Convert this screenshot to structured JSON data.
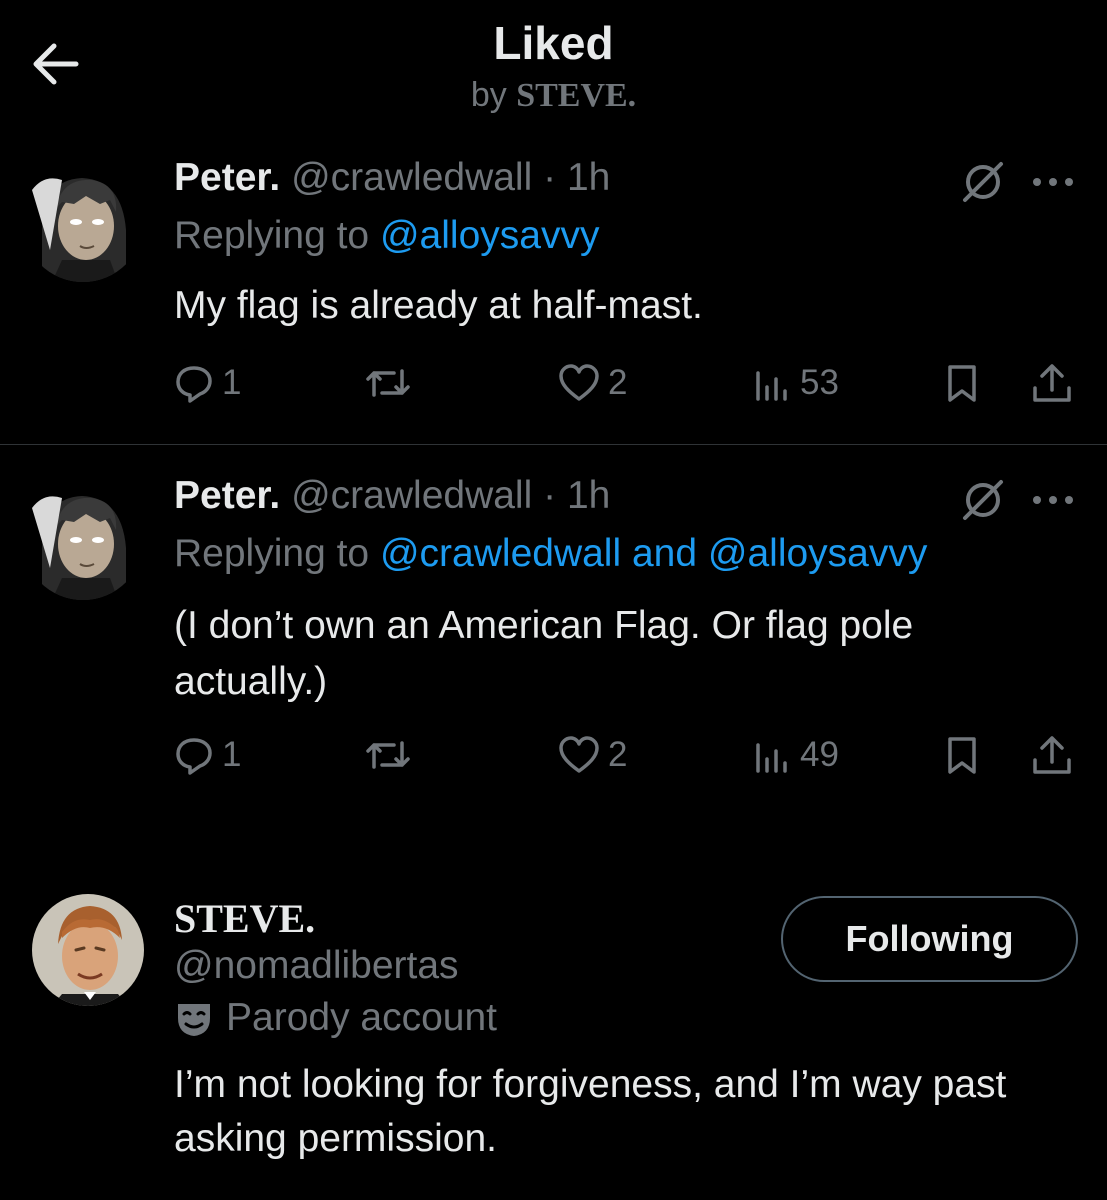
{
  "header": {
    "title": "Liked",
    "subtitle_prefix": "by",
    "subtitle_name": "STEVE."
  },
  "tweets": [
    {
      "name": "Peter.",
      "handle": "@crawledwall",
      "dot": "·",
      "time": "1h",
      "replying_prefix": "Replying to",
      "replying_to": "@alloysavvy",
      "text": "My flag is already at half-mast.",
      "replies": "1",
      "likes": "2",
      "views": "53"
    },
    {
      "name": "Peter.",
      "handle": "@crawledwall",
      "dot": "·",
      "time": "1h",
      "replying_prefix": "Replying to",
      "replying_to": "@crawledwall and @alloysavvy",
      "text": "(I don’t own an American Flag. Or flag pole actually.)",
      "replies": "1",
      "likes": "2",
      "views": "49"
    }
  ],
  "profile": {
    "name": "STEVE.",
    "handle": "@nomadlibertas",
    "label": "Parody account",
    "follow_label": "Following",
    "bio": "I’m not looking for forgiveness, and I’m way past asking permission."
  },
  "colors": {
    "background": "#000000",
    "text": "#e7e9ea",
    "muted": "#71767b",
    "link": "#1d9bf0",
    "divider": "#2f3336"
  },
  "icons": [
    "back-arrow-icon",
    "grok-icon",
    "more-icon",
    "reply-icon",
    "repost-icon",
    "like-icon",
    "views-icon",
    "bookmark-icon",
    "share-icon",
    "parody-mask-icon"
  ]
}
